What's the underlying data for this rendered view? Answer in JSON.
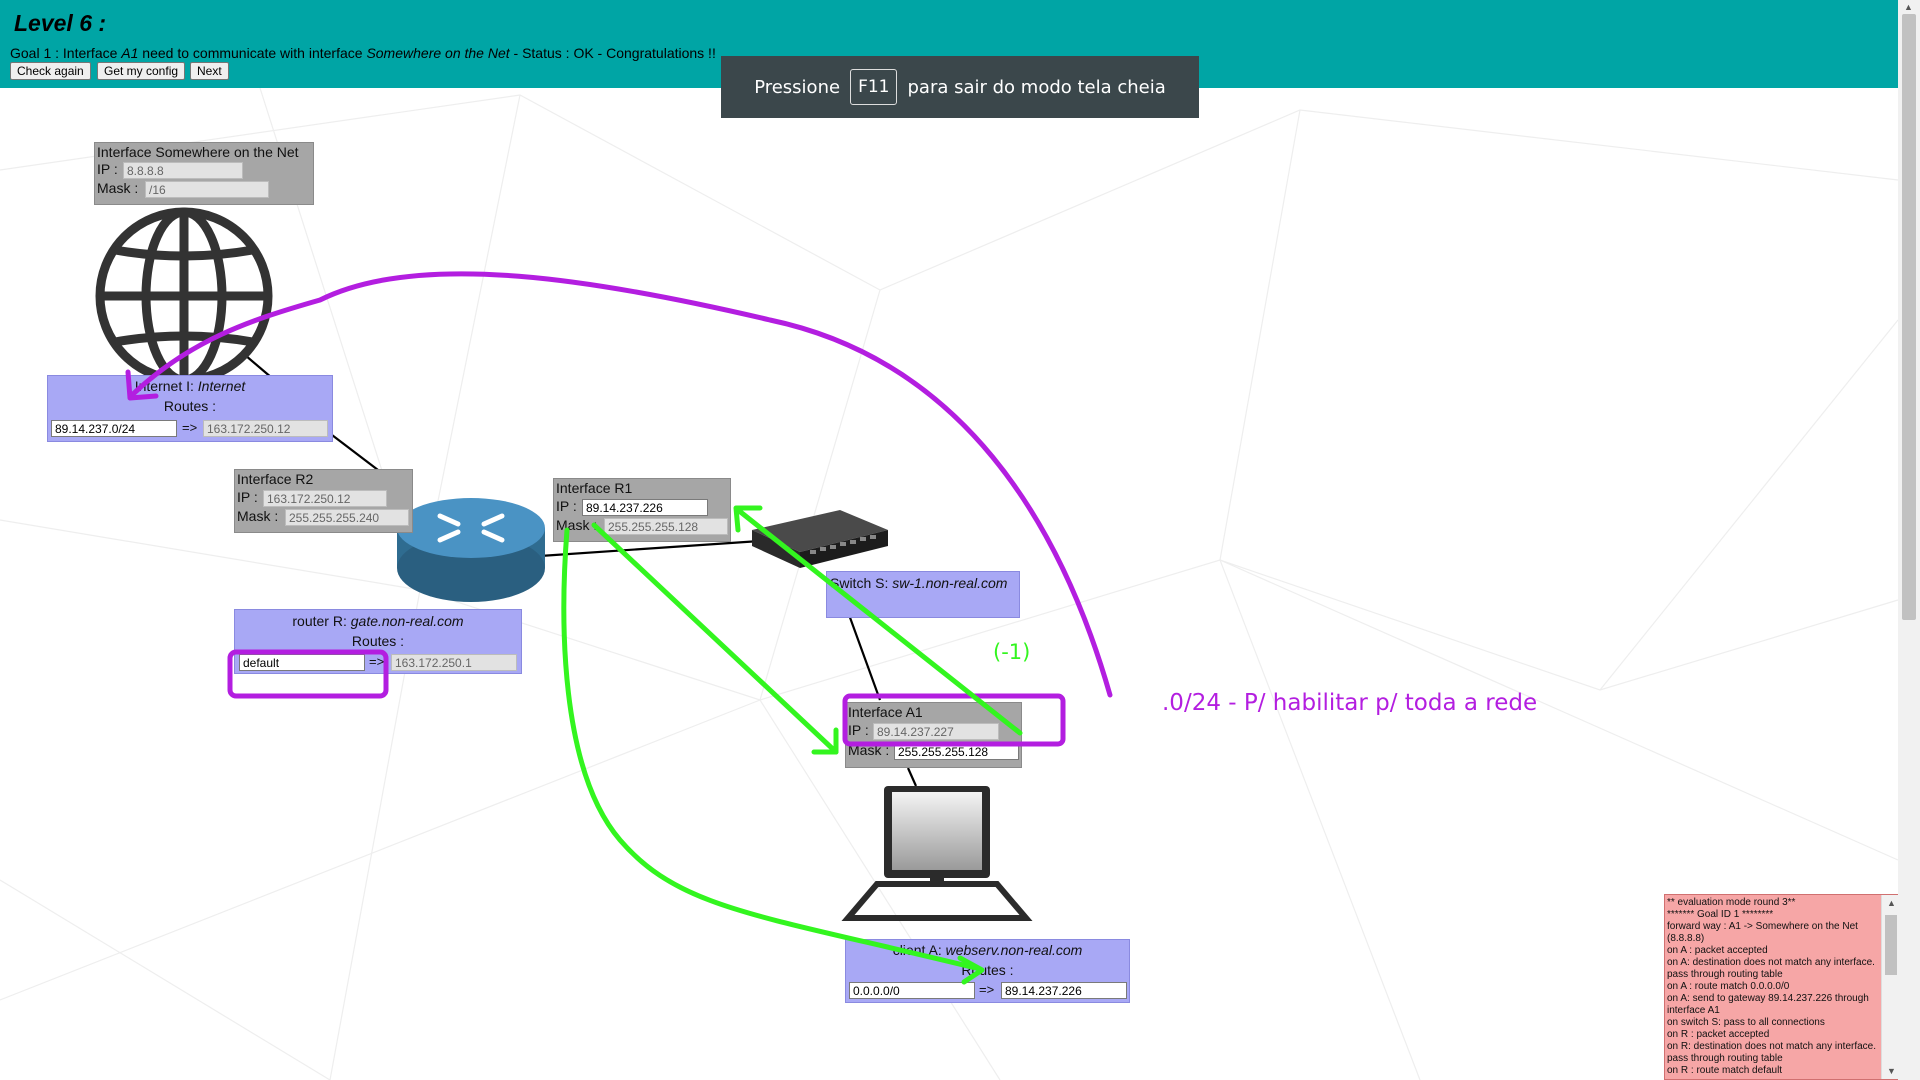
{
  "header": {
    "title": "Level 6 :",
    "goal_prefix": "Goal 1 : Interface ",
    "goal_from": "A1",
    "goal_mid": " need to communicate with interface ",
    "goal_to": "Somewhere on the Net",
    "goal_status": " - Status : OK - Congratulations !!",
    "buttons": {
      "check": "Check again",
      "config": "Get my config",
      "next": "Next"
    }
  },
  "fullscreen_toast": {
    "before": "Pressione",
    "key": "F11",
    "after": "para sair do modo tela cheia"
  },
  "interface_net": {
    "title": "Interface Somewhere on the Net",
    "ip_label": "IP :",
    "ip": "8.8.8.8",
    "mask_label": "Mask :",
    "mask": "/16"
  },
  "internet_node": {
    "title_prefix": "Internet I: ",
    "title_name": "Internet",
    "routes_label": "Routes :",
    "route_dest": "89.14.237.0/24",
    "arrow": "=>",
    "route_gw": "163.172.250.12"
  },
  "interface_r2": {
    "title": "Interface R2",
    "ip_label": "IP :",
    "ip": "163.172.250.12",
    "mask_label": "Mask :",
    "mask": "255.255.255.240"
  },
  "router_node": {
    "title_prefix": "router R: ",
    "title_name": "gate.non-real.com",
    "routes_label": "Routes :",
    "route_dest": "default",
    "arrow": "=>",
    "route_gw": "163.172.250.1"
  },
  "interface_r1": {
    "title": "Interface R1",
    "ip_label": "IP :",
    "ip": "89.14.237.226",
    "mask_label": "Mask :",
    "mask": "255.255.255.128"
  },
  "switch_node": {
    "title_prefix": "Switch S: ",
    "title_name": "sw-1.non-real.com"
  },
  "interface_a1": {
    "title": "Interface A1",
    "ip_label": "IP :",
    "ip": "89.14.237.227",
    "mask_label": "Mask :",
    "mask": "255.255.255.128"
  },
  "client_node": {
    "title_prefix": "client A: ",
    "title_name": "webserv.non-real.com",
    "routes_label": "Routes :",
    "route_dest": "0.0.0.0/0",
    "arrow": "=>",
    "route_gw": "89.14.237.226"
  },
  "annotations": {
    "minus_one": "(-1)",
    "note": ".0/24 - P/ habilitar p/ toda a rede",
    "purple": "#b31ee0",
    "green": "#33f51f"
  },
  "log": {
    "lines": "** evaluation mode round 3**\n******* Goal ID 1 ********\nforward way : A1 -> Somewhere on the Net (8.8.8.8)\non A : packet accepted\non A: destination does not match any interface. pass through routing table\non A : route match 0.0.0.0/0\non A: send to gateway 89.14.237.226 through interface A1\non switch S: pass to all connections\non R : packet accepted\non R: destination does not match any interface. pass through routing table\non R : route match default"
  },
  "icons": [
    "globe-icon",
    "router-icon",
    "switch-icon",
    "computer-icon"
  ]
}
